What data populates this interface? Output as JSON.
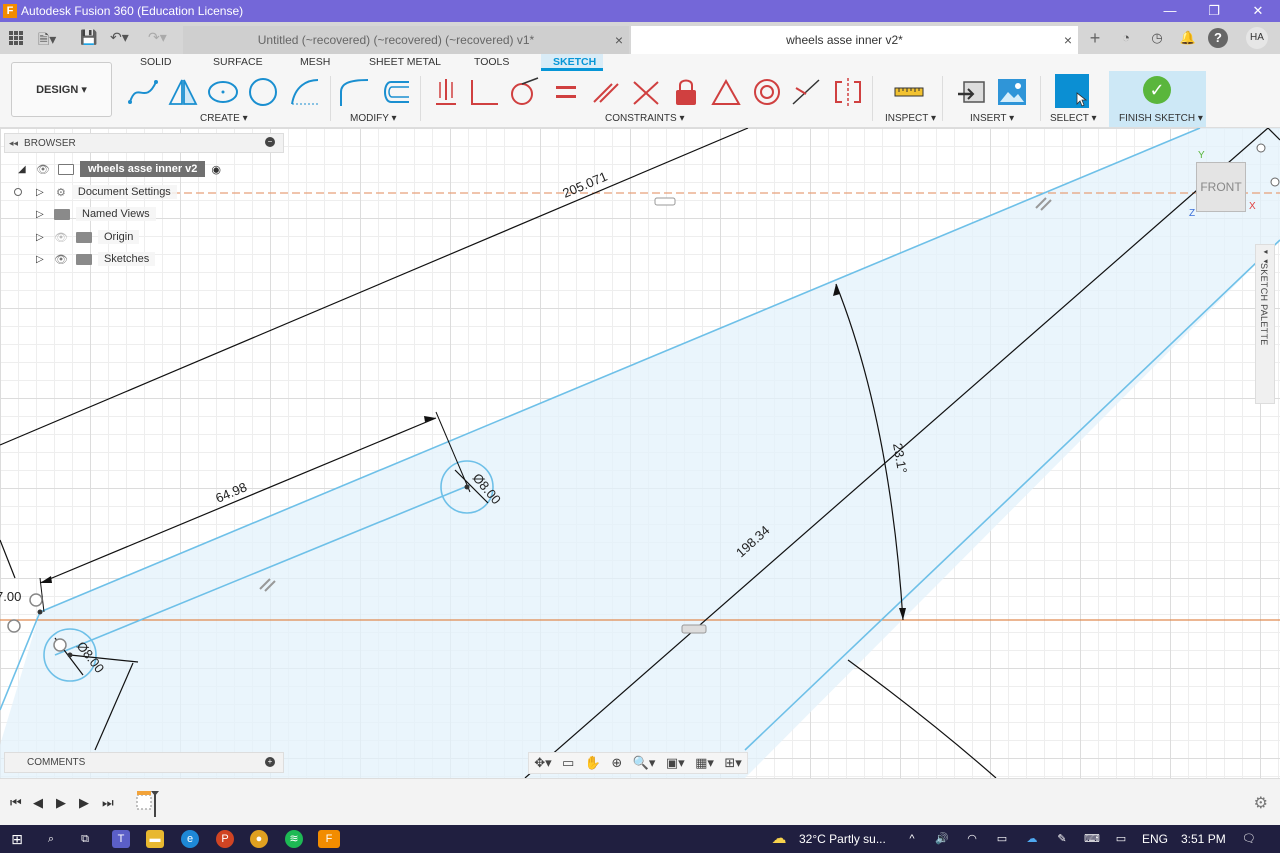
{
  "window": {
    "title": "Autodesk Fusion 360 (Education License)",
    "app_icon": "F",
    "minimize": "—",
    "restore": "❐",
    "close": "✕"
  },
  "tabs": [
    {
      "label": "Untitled (~recovered) (~recovered) (~recovered) v1*",
      "active": false
    },
    {
      "label": "wheels asse inner v2*",
      "active": true
    }
  ],
  "user_initials": "HA",
  "toolbar": {
    "workspace_button": "DESIGN ▾",
    "workspace_tabs": [
      "SOLID",
      "SURFACE",
      "MESH",
      "SHEET METAL",
      "TOOLS",
      "SKETCH"
    ],
    "active_tab": "SKETCH",
    "groups": {
      "create": "CREATE ▾",
      "modify": "MODIFY ▾",
      "constraints": "CONSTRAINTS ▾",
      "inspect": "INSPECT ▾",
      "insert": "INSERT ▾",
      "select": "SELECT ▾",
      "finish": "FINISH SKETCH ▾"
    }
  },
  "browser": {
    "title": "BROWSER",
    "root": "wheels asse inner v2",
    "items": [
      "Document Settings",
      "Named Views",
      "Origin",
      "Sketches"
    ]
  },
  "comments_label": "COMMENTS",
  "viewcube": {
    "face": "FRONT",
    "axis_y": "Y",
    "axis_x": "X",
    "axis_z": "Z"
  },
  "sketch_palette_label": "SKETCH PALETTE",
  "dimensions": {
    "d1": "205.071",
    "d2": "64.98",
    "d3": "Ø8.00",
    "d4": "Ø8.00",
    "d5": "198.34",
    "d6": "23.1°",
    "d7": "7.00"
  },
  "taskbar": {
    "weather": "32°C  Partly su...",
    "lang": "ENG",
    "time": "3:51 PM"
  },
  "colors": {
    "title_bar": "#7467d8",
    "accent": "#0696d7",
    "sketch_line": "#6ec0e8",
    "profile_fill": "#e3f2fb",
    "finish_green": "#5ab63c"
  }
}
